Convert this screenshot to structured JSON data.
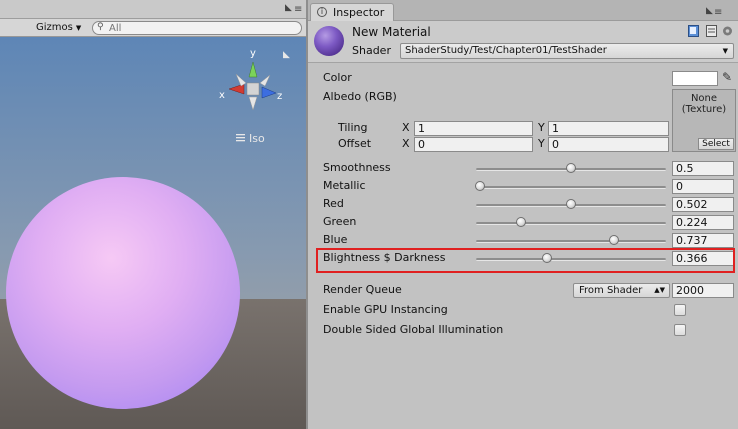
{
  "scene": {
    "gizmos_label": "Gizmos",
    "search_placeholder": "All",
    "axis_x": "x",
    "axis_y": "y",
    "axis_z": "z",
    "projection_label": "Iso"
  },
  "inspector": {
    "tab_label": "Inspector",
    "material_name": "New Material",
    "shader_label": "Shader",
    "shader_value": "ShaderStudy/Test/Chapter01/TestShader",
    "color_label": "Color",
    "color_value": "#ffffff",
    "albedo_label": "Albedo (RGB)",
    "texture_none": "None",
    "texture_type": "(Texture)",
    "texture_select": "Select",
    "tiling_label": "Tiling",
    "offset_label": "Offset",
    "x_label": "X",
    "y_label": "Y",
    "tiling_x": "1",
    "tiling_y": "1",
    "offset_x": "0",
    "offset_y": "0",
    "sliders": [
      {
        "label": "Smoothness",
        "value": "0.5",
        "fraction": 0.5
      },
      {
        "label": "Metallic",
        "value": "0",
        "fraction": 0.0
      },
      {
        "label": "Red",
        "value": "0.502",
        "fraction": 0.502
      },
      {
        "label": "Green",
        "value": "0.224",
        "fraction": 0.224
      },
      {
        "label": "Blue",
        "value": "0.737",
        "fraction": 0.737
      },
      {
        "label": "Blightness $ Darkness",
        "value": "0.366",
        "fraction": 0.366
      }
    ],
    "render_queue_label": "Render Queue",
    "render_queue_mode": "From Shader",
    "render_queue_value": "2000",
    "gpu_instancing_label": "Enable GPU Instancing",
    "double_sided_gi_label": "Double Sided Global Illumination"
  },
  "colors": {
    "highlight": "#e02020",
    "sphere": "#d9a6f2",
    "sky": "#6d93bf",
    "ground": "#6e6660"
  }
}
